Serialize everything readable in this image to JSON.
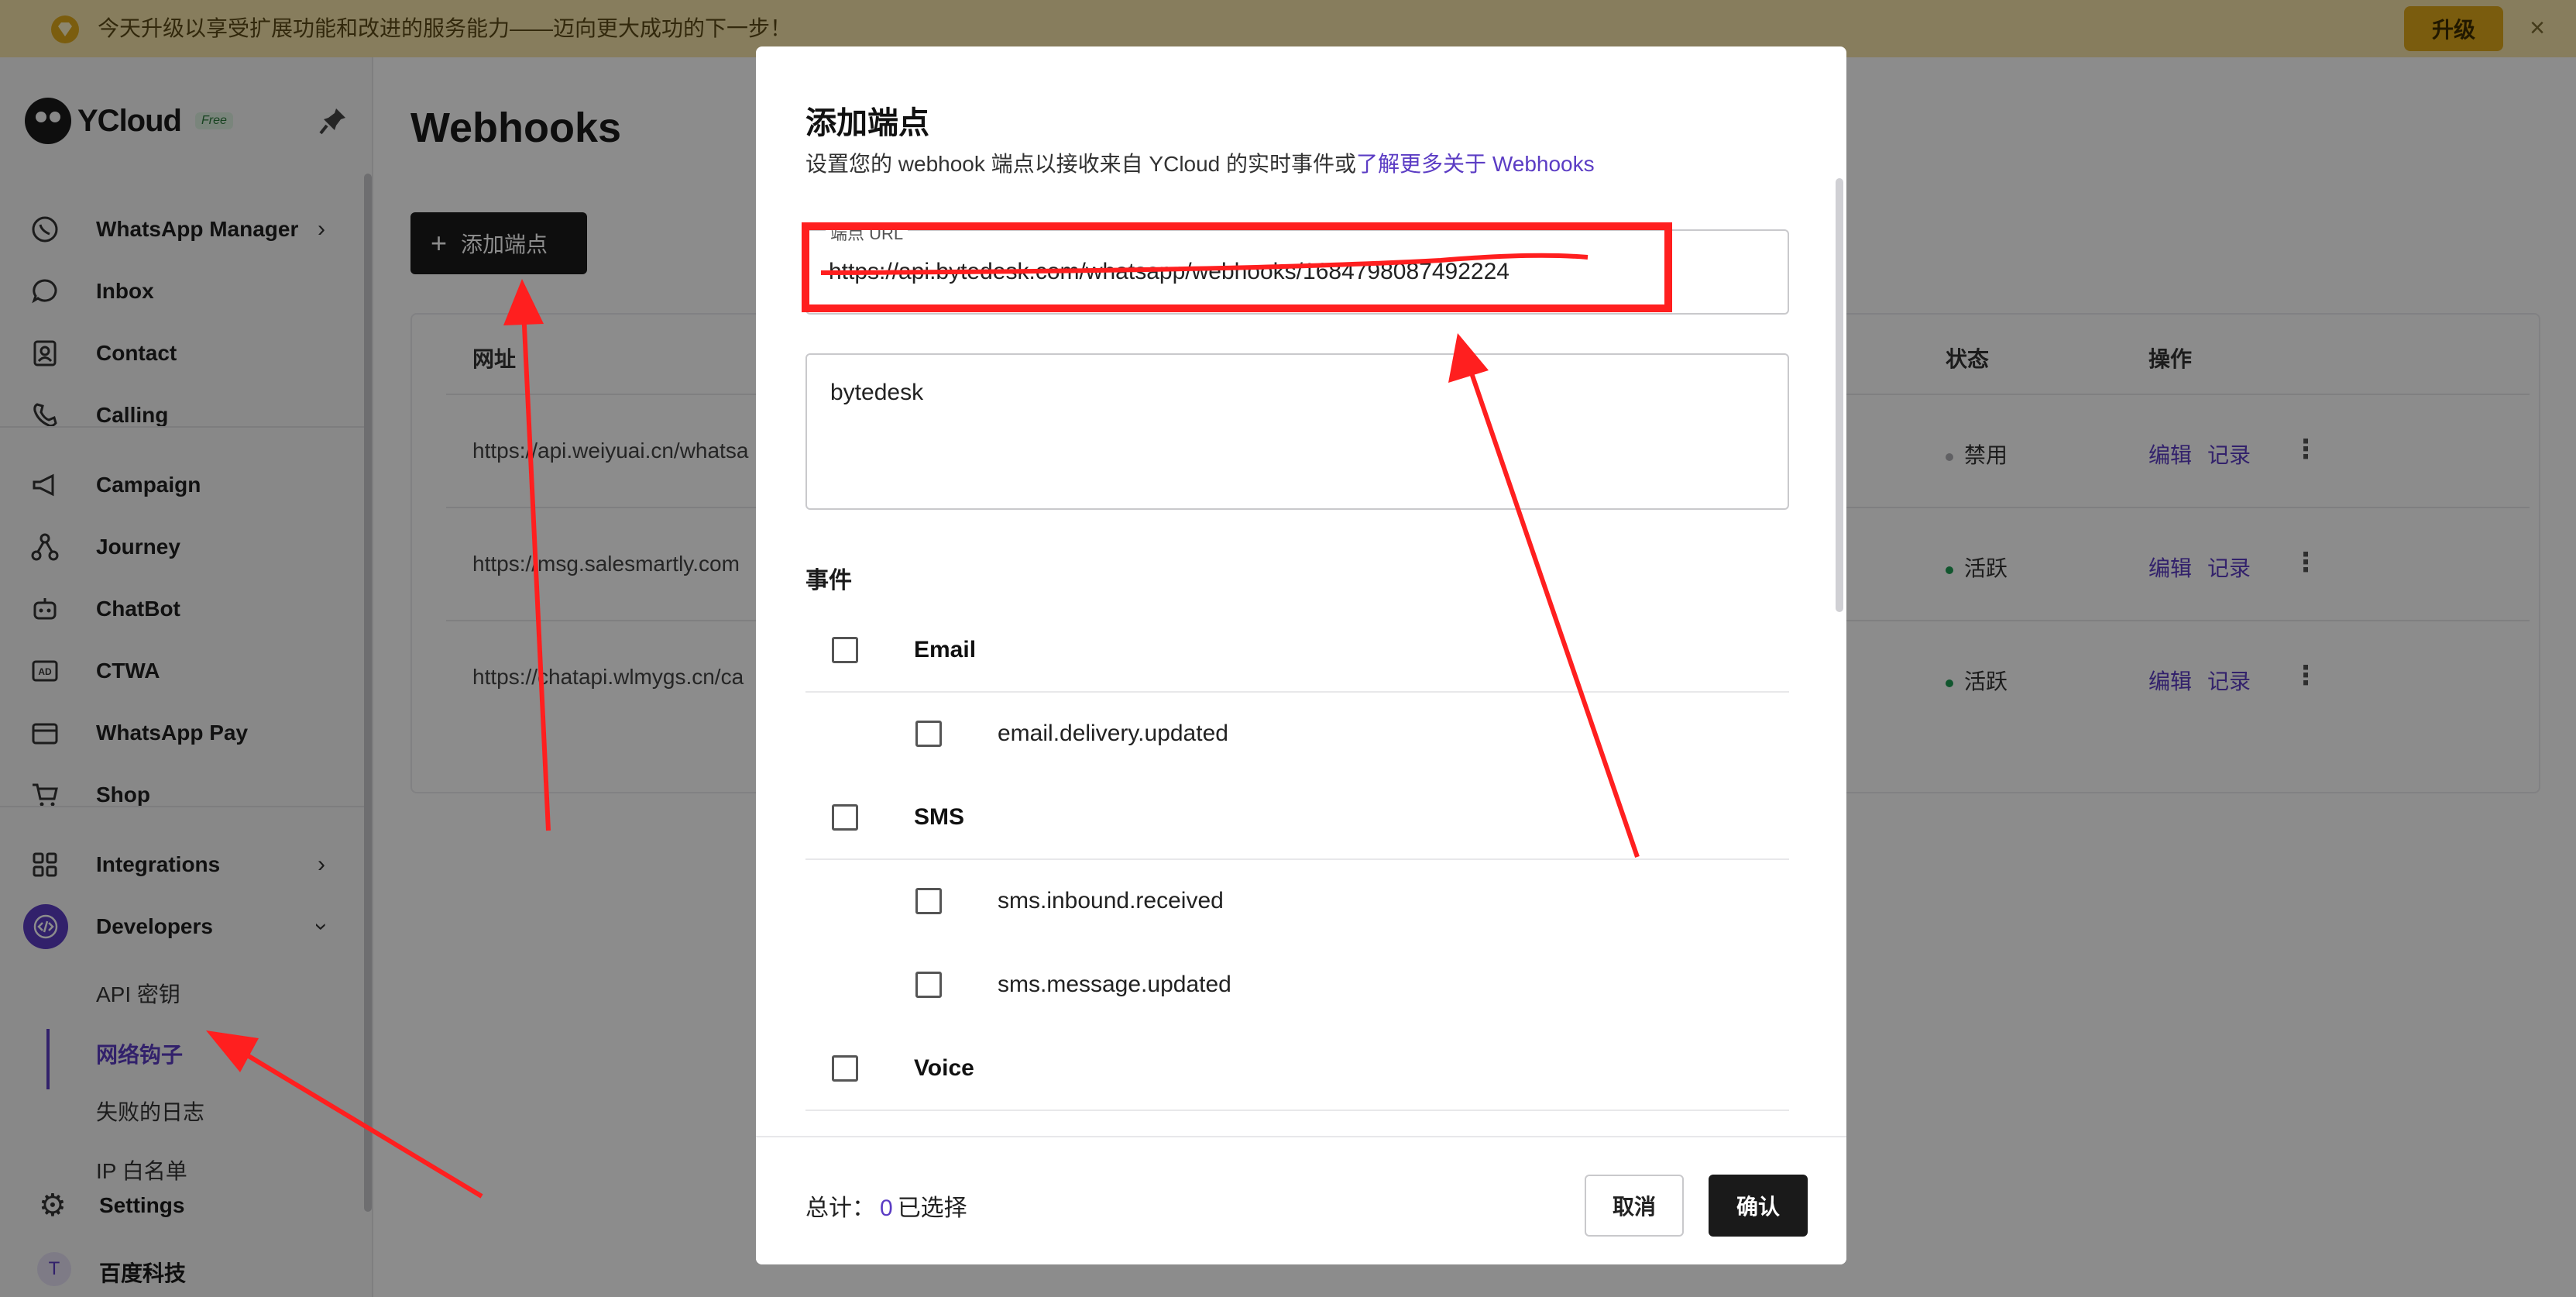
{
  "banner": {
    "text": "今天升级以享受扩展功能和改进的服务能力——迈向更大成功的下一步！",
    "upgrade_label": "升级",
    "close_label": "×"
  },
  "sidebar": {
    "brand": "YCloud",
    "plan_badge": "Free",
    "items": [
      {
        "label": "WhatsApp Manager",
        "icon": "whatsapp-icon"
      },
      {
        "label": "Inbox",
        "icon": "chat-bubble-icon"
      },
      {
        "label": "Contact",
        "icon": "contact-card-icon"
      },
      {
        "label": "Calling",
        "icon": "phone-icon"
      },
      {
        "label": "Campaign",
        "icon": "megaphone-icon"
      },
      {
        "label": "Journey",
        "icon": "journey-icon"
      },
      {
        "label": "ChatBot",
        "icon": "bot-icon"
      },
      {
        "label": "CTWA",
        "icon": "ad-icon"
      },
      {
        "label": "WhatsApp Pay",
        "icon": "wallet-icon"
      },
      {
        "label": "Shop",
        "icon": "cart-icon"
      },
      {
        "label": "Integrations",
        "icon": "grid-icon"
      },
      {
        "label": "Developers",
        "icon": "code-icon"
      }
    ],
    "sub_items": [
      "API 密钥",
      "网络钩子",
      "失败的日志",
      "IP 白名单"
    ],
    "settings_label": "Settings",
    "org_initial": "T",
    "org_name": "百度科技"
  },
  "main": {
    "title": "Webhooks",
    "add_button": "添加端点",
    "columns": {
      "url": "网址",
      "status": "状态",
      "actions": "操作"
    },
    "rows": [
      {
        "url": "https://api.weiyuai.cn/whatsa",
        "status": "禁用",
        "status_color": "#b0b0b4",
        "edit": "编辑",
        "log": "记录"
      },
      {
        "url": "https://msg.salesmartly.com",
        "status": "活跃",
        "status_color": "#1f9d55",
        "edit": "编辑",
        "log": "记录"
      },
      {
        "url": "https://chatapi.wlmygs.cn/ca",
        "status": "活跃",
        "status_color": "#1f9d55",
        "edit": "编辑",
        "log": "记录"
      }
    ]
  },
  "modal": {
    "title": "添加端点",
    "subtitle": "设置您的 webhook 端点以接收来自 YCloud 的实时事件或",
    "learn_more": "了解更多关于 Webhooks",
    "url_label": "端点 URL",
    "url_value": "https://api.bytedesk.com/whatsapp/webhooks/1684798087492224",
    "description_value": "bytedesk",
    "events_title": "事件",
    "groups": [
      {
        "name": "Email",
        "items": [
          "email.delivery.updated"
        ]
      },
      {
        "name": "SMS",
        "items": [
          "sms.inbound.received",
          "sms.message.updated"
        ]
      },
      {
        "name": "Voice",
        "items": []
      }
    ],
    "total_label": "总计：",
    "selected_count": "0",
    "selected_label": "已选择",
    "cancel_label": "取消",
    "confirm_label": "确认"
  },
  "colors": {
    "accent": "#5b3cc4",
    "annotation": "#ff1f1f",
    "banner": "#f6e3a9"
  }
}
